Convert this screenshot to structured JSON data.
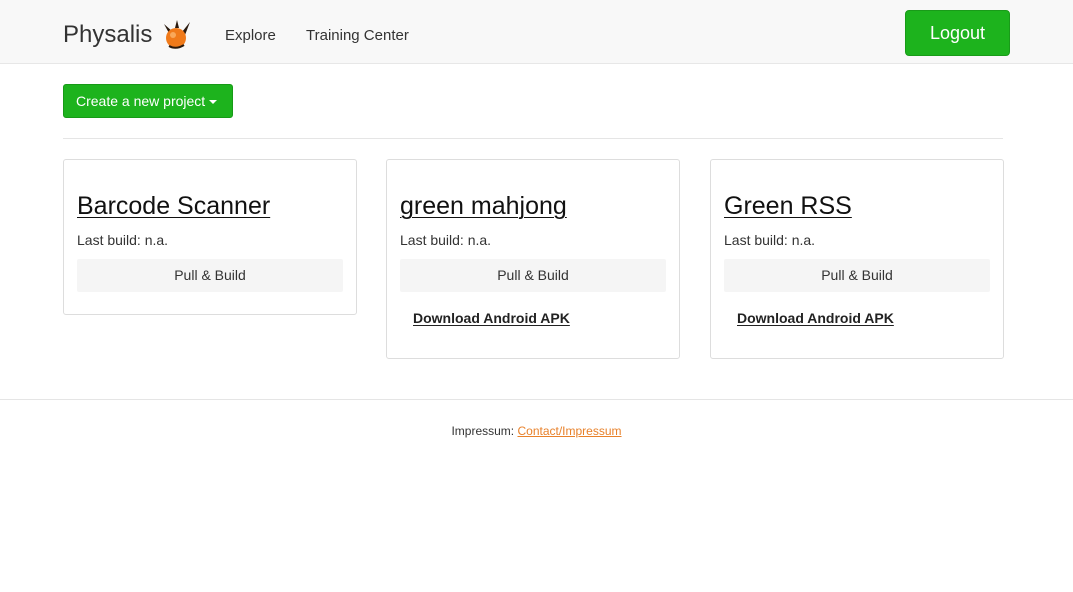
{
  "navbar": {
    "brand": "Physalis",
    "brand_logo_icon": "physalis-fruit-icon",
    "links": [
      "Explore",
      "Training Center"
    ],
    "logout_label": "Logout"
  },
  "toolbar": {
    "create_label": "Create a new project",
    "create_caret_icon": "caret-down-icon"
  },
  "projects": [
    {
      "title": "Barcode Scanner",
      "build": "Last build: n.a.",
      "pull_label": "Pull & Build"
    },
    {
      "title": "green mahjong",
      "build": "Last build: n.a.",
      "pull_label": "Pull & Build",
      "download_label": "Download Android APK"
    },
    {
      "title": "Green RSS",
      "build": "Last build: n.a.",
      "pull_label": "Pull & Build",
      "download_label": "Download Android APK"
    }
  ],
  "footer": {
    "label": "Impressum:",
    "link": "Contact/Impressum"
  },
  "colors": {
    "accent_green": "#1db31d",
    "footer_link": "#e8812a",
    "navbar_bg": "#f8f8f8",
    "logo_orange": "#f07a1a"
  }
}
